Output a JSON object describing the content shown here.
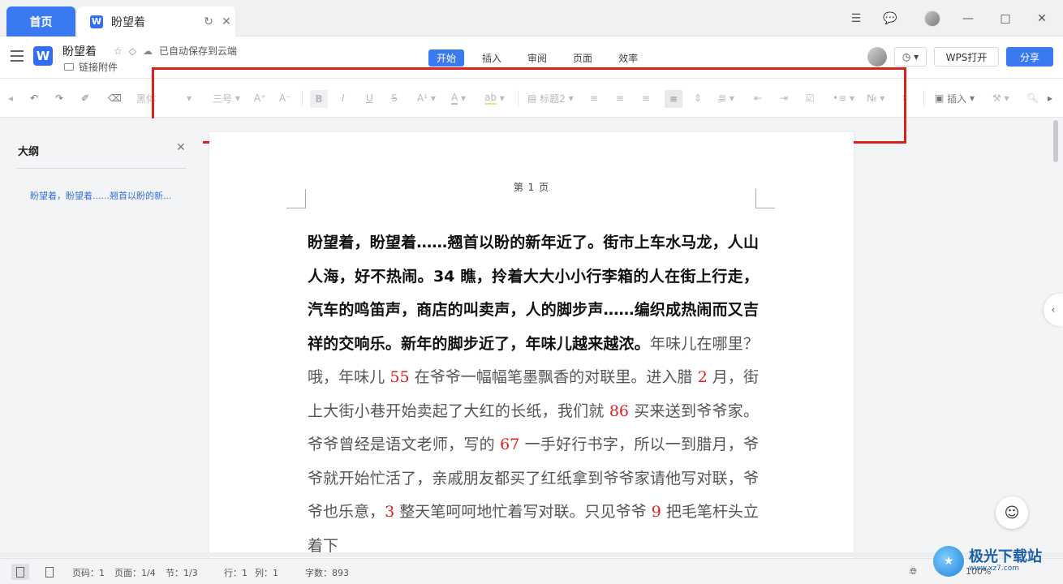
{
  "tabs": {
    "home_label": "首页",
    "doc_label": "盼望着",
    "doc_logo": "W"
  },
  "docbar": {
    "doc_name": "盼望着",
    "autosave_text": "已自动保存到云端",
    "attach_label": "链接附件",
    "logo": "W",
    "ribbon_tabs": [
      "开始",
      "插入",
      "审阅",
      "页面",
      "效率"
    ],
    "wps_open_label": "WPS打开",
    "share_label": "分享"
  },
  "toolbar": {
    "font_name": "黑体",
    "font_size": "三号",
    "style_name": "标题2",
    "insert_label": "插入"
  },
  "outline": {
    "title": "大纲",
    "item": "盼望着，盼望着......翘首以盼的新..."
  },
  "page": {
    "page_label": "第 1 页",
    "bold_text": "盼望着，盼望着……翘首以盼的新年近了。街市上车水马龙，人山人海，好不热闹。34 瞧，拎着大大小小行李箱的人在街上行走，汽车的鸣笛声，商店的叫卖声，人的脚步声……编织成热闹而又吉祥的交响乐。新年的脚步近了，年味儿越来越浓。",
    "segments": [
      {
        "t": "年味儿在哪里？哦，年味儿 ",
        "c": "normal"
      },
      {
        "t": "55",
        "c": "num"
      },
      {
        "t": " 在爷爷一幅幅笔墨飘香的对联里。进入腊 ",
        "c": "normal"
      },
      {
        "t": "2",
        "c": "num"
      },
      {
        "t": " 月，街上大街小巷开始卖起了大红的长纸，我们就 ",
        "c": "normal"
      },
      {
        "t": "86",
        "c": "num"
      },
      {
        "t": " 买来送到爷爷家。爷爷曾经是语文老师，写的 ",
        "c": "normal"
      },
      {
        "t": "67",
        "c": "num"
      },
      {
        "t": " 一手好行书字，所以一到腊月，爷爷就开始忙活了，亲戚朋友都买了红纸拿到爷爷家请他写对联，爷爷也乐意，",
        "c": "normal"
      },
      {
        "t": "3",
        "c": "num"
      },
      {
        "t": " 整天笔呵呵地忙着写对联。只见爷爷 ",
        "c": "normal"
      },
      {
        "t": "9",
        "c": "num"
      },
      {
        "t": " 把毛笔杆头立着下",
        "c": "normal"
      }
    ]
  },
  "statusbar": {
    "page_code": "页码：1",
    "pages": "页面：1/4",
    "section": "节：1/3",
    "row": "行：1",
    "col": "列：1",
    "word_count": "字数：893",
    "zoom": "100%"
  },
  "watermark": {
    "name": "极光下载站",
    "url": "www.xz7.com"
  },
  "colors": {
    "accent": "#3a7af0",
    "highlight_border": "#d9221d",
    "number_red": "#e02020"
  }
}
